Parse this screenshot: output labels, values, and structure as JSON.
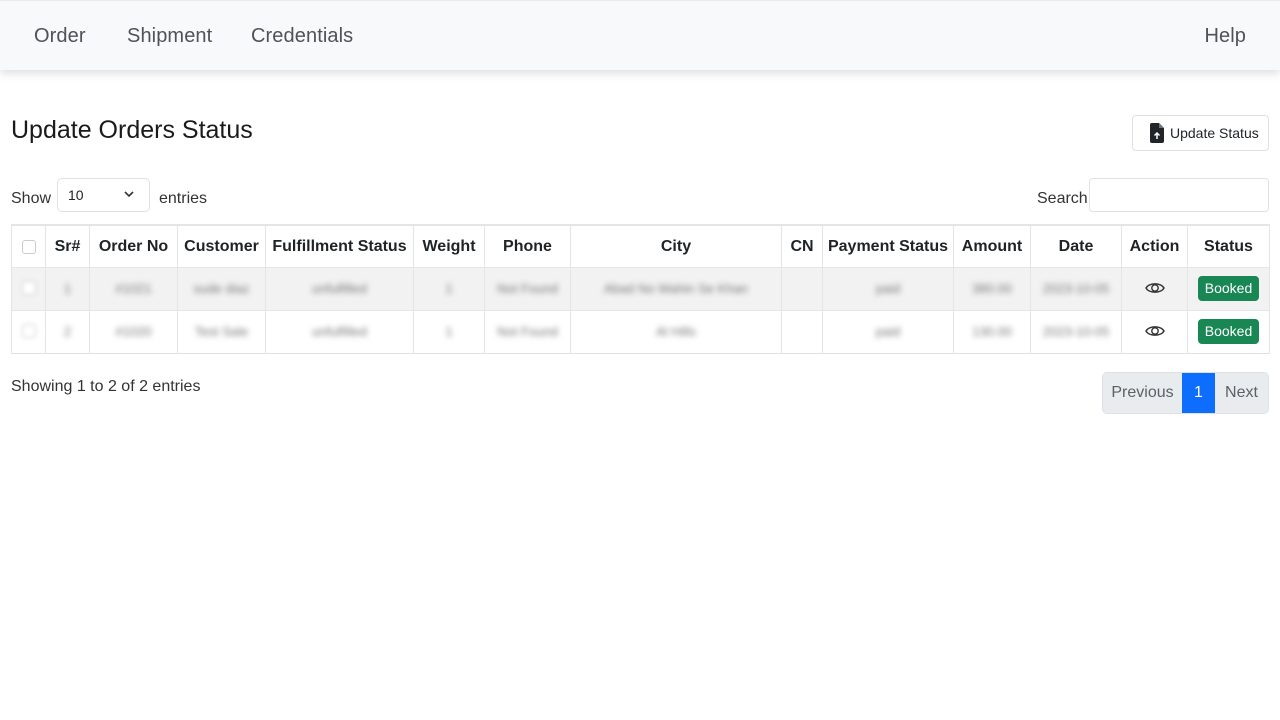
{
  "navbar": {
    "items": [
      {
        "label": "Order"
      },
      {
        "label": "Shipment"
      },
      {
        "label": "Credentials"
      }
    ],
    "help_label": "Help"
  },
  "page": {
    "title": "Update Orders Status",
    "update_button_label": "Update Status",
    "update_button_icon": "file-upload-icon"
  },
  "controls": {
    "show_label": "Show",
    "entries_value": "10",
    "entries_label": "entries",
    "search_label": "Search:",
    "search_value": ""
  },
  "table": {
    "columns": [
      "Sr#",
      "Order No",
      "Customer",
      "Fulfillment Status",
      "Weight",
      "Phone",
      "City",
      "CN",
      "Payment Status",
      "Amount",
      "Date",
      "Action",
      "Status"
    ],
    "rows": [
      {
        "sr": "1",
        "order_no": "#1021",
        "customer": "sude diaz",
        "fulfillment": "unfulfilled",
        "weight": "1",
        "phone": "Not Found",
        "city": "Abad No Wahin Se Khan",
        "cn": "",
        "payment": "paid",
        "amount": "380.00",
        "date": "2023-10-05",
        "action_icon": "eye-icon",
        "status": "Booked"
      },
      {
        "sr": "2",
        "order_no": "#1020",
        "customer": "Test Sale",
        "fulfillment": "unfulfilled",
        "weight": "1",
        "phone": "Not Found",
        "city": "Al Hills",
        "cn": "",
        "payment": "paid",
        "amount": "130.00",
        "date": "2023-10-05",
        "action_icon": "eye-icon",
        "status": "Booked"
      }
    ]
  },
  "footer": {
    "info": "Showing 1 to 2 of 2 entries",
    "pagination": {
      "previous": "Previous",
      "current": "1",
      "next": "Next"
    }
  },
  "colors": {
    "accent": "#0d6efd",
    "badge_success": "#198754",
    "navbar_bg": "#f8f9fa"
  }
}
